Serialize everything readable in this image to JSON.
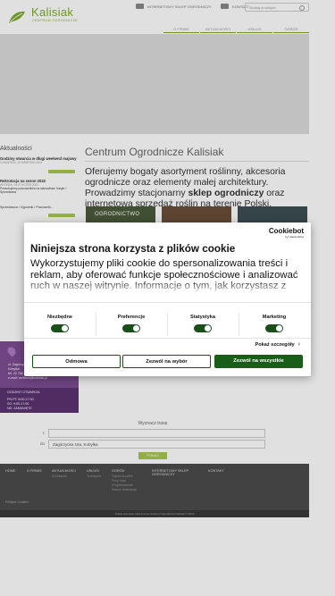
{
  "header": {
    "logo_title": "Kalisiak",
    "logo_sub": "CENTRUM OGRODNICZE",
    "top_links": [
      "INTERNETOWY SKLEP OGRODNICZY",
      "KONTAKT"
    ],
    "search_placeholder": "Szukaj w sklepie",
    "nav": [
      "O FIRMIE",
      "AKTUALNOŚCI",
      "USŁUGI",
      "OGRÓD"
    ]
  },
  "news": {
    "title": "Aktualności",
    "items": [
      {
        "title": "Godziny otwarcia w długi weekend majowy",
        "date": "CZWARTEK, 28 KWIETNIA 2022"
      },
      {
        "title": "Rekrutacja na sezon 2022",
        "date": "WTOREK, 04 STYCZEŃ 2022",
        "text": "Poszukujemy pracowników na stanowiska: Kasjer / Sprzedawca"
      },
      {
        "title": "Sprzedawca / Ogrodnik / Pracownik..."
      }
    ]
  },
  "content": {
    "title": "Centrum Ogrodnicze Kalisiak",
    "para_start": "Oferujemy bogaty asortyment roślinny, akcesoria ogrodnicze oraz elementy małej architektury. Prowadzimy stacjonarny ",
    "para_bold": "sklep ogrodniczy",
    "para_end": " oraz internetową sprzedaż roślin na terenie Polski.",
    "thumbs": [
      "OGRODNICTWO",
      "",
      ""
    ]
  },
  "contact": {
    "lines": [
      "ul. Zagórzycka 16a,",
      "Kobyłka",
      "tel. 22 786 12 13",
      "e-mail: centrum@kalisiak.pl"
    ],
    "hours_title": "GODZINY OTWARCIA",
    "hours": [
      "PN-PT: 8:00-17:00",
      "SO: 9:00-17:00",
      "ND: ZAMKNIĘTE"
    ]
  },
  "route": {
    "title": "Wyznacz trasę",
    "from_label": "z",
    "to_label": "do",
    "to_value": "Zagórzycka 16a, Kobyłka",
    "button": "POKAŻ"
  },
  "footer": {
    "cols": [
      {
        "head": "HOME",
        "subs": []
      },
      {
        "head": "O FIRMIE",
        "subs": []
      },
      {
        "head": "AKTUALNOŚCI",
        "subs": [
          "Archiwum"
        ]
      },
      {
        "head": "USŁUGI",
        "subs": [
          "Transport"
        ]
      },
      {
        "head": "OGRÓD",
        "subs": [
          "Ogród w pełni",
          "Pory roku",
          "Projektowanie",
          "Nasze realizacje"
        ]
      },
      {
        "head": "INTERNETOWY SKLEP OGRODNICZY",
        "subs": []
      },
      {
        "head": "KONTAKT",
        "subs": []
      }
    ],
    "polityka": "Polityka Cookies",
    "bottom": "Prawa autorskie zastrzeżone Centrum Ogrodnicze Kalisiak © 2022"
  },
  "cookie": {
    "logo": "Cookiebot",
    "logo_by": "by Usercentrics",
    "title": "Niniejsza strona korzysta z plików cookie",
    "body": "Wykorzystujemy pliki cookie do spersonalizowania treści i reklam, aby oferować funkcje społecznościowe i analizować ruch w naszej witrynie. Informacje o tym, jak korzystasz z naszej witryny,",
    "consents": [
      "Niezbędne",
      "Preferencje",
      "Statystyka",
      "Marketing"
    ],
    "details": "Pokaż szczegóły",
    "buttons": {
      "deny": "Odmowa",
      "select": "Zezwól na wybór",
      "allow": "Zezwól na wszystkie"
    },
    "colors": {
      "primary": "#1a5c1a",
      "toggle": "#1a4f1a"
    }
  },
  "colors": {
    "brand_green": "#7bab2d",
    "contact_purple": "#7d4d92"
  }
}
